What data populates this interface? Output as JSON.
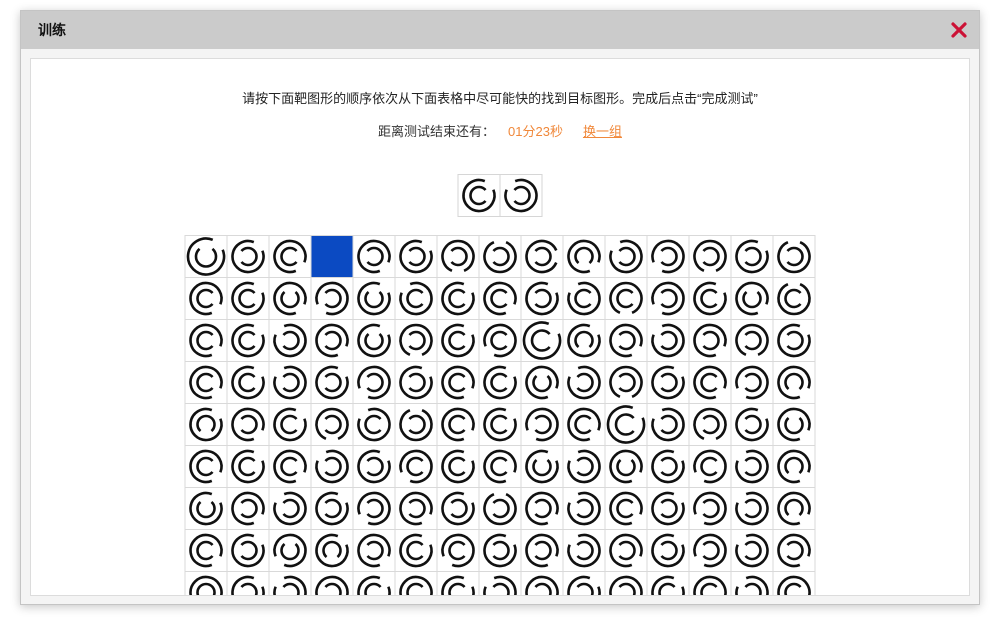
{
  "window": {
    "title": "训练"
  },
  "instructions": "请按下面靶图形的顺序依次从下面表格中尽可能快的找到目标图形。完成后点击“完成测试”",
  "timer": {
    "label": "距离测试结束还有：",
    "remaining": "01分23秒"
  },
  "reshuffle_link": "换一组",
  "targets": [
    "NE-E",
    "NW-W"
  ],
  "grid": {
    "rows": [
      [
        "NE-N-L",
        "NE-W",
        "SE-E",
        "selected",
        "SE-W",
        "NE-W",
        "S-W",
        "N-W",
        "E-W",
        "SE-S",
        "NW-W",
        "SW-W",
        "S-W",
        "NE-W",
        "N-W"
      ],
      [
        "SE-E",
        "NE-E",
        "SE-N",
        "SW-W",
        "NE-N",
        "NW-E",
        "NE-E",
        "SE-E",
        "NE-W",
        "NW-E",
        "S-E",
        "SW-W",
        "NE-E",
        "SE-N",
        "N-E"
      ],
      [
        "SE-E",
        "NE-E",
        "NW-W",
        "SE-W",
        "NE-N",
        "S-W",
        "NE-E",
        "SW-E",
        "NE-E-L",
        "NE-S",
        "SE-W",
        "NW-W",
        "SE-W",
        "S-W",
        "NE-W"
      ],
      [
        "SE-E",
        "NE-E",
        "NW-W",
        "NE-W",
        "SW-W",
        "NE-W",
        "SE-E",
        "NE-E",
        "SE-N",
        "NW-W",
        "S-W",
        "NE-W",
        "SE-E",
        "SW-W",
        "SE-S"
      ],
      [
        "NE-S",
        "SE-W",
        "NE-E",
        "S-W",
        "NW-E",
        "N-W",
        "SE-E",
        "NE-E",
        "SW-W",
        "SE-E",
        "NE-E-L",
        "NW-W",
        "S-W",
        "NE-W",
        "SE-N"
      ],
      [
        "SE-E",
        "NE-E",
        "SE-E",
        "NW-W",
        "NE-W",
        "SW-E",
        "NE-E",
        "SE-E",
        "NE-N",
        "NW-W",
        "SE-N",
        "NE-W",
        "SW-E",
        "NW-W",
        "SE-S"
      ],
      [
        "NE-N",
        "SE-W",
        "NW-W",
        "NE-W",
        "SW-W",
        "SE-W",
        "NE-W",
        "N-W",
        "SE-W",
        "NW-W",
        "SE-E",
        "NE-W",
        "SW-W",
        "NW-W",
        "SE-S"
      ],
      [
        "SE-E",
        "NE-W",
        "SW-N",
        "NE-S",
        "SE-W",
        "NE-E",
        "SW-E",
        "NE-W",
        "SE-W",
        "NW-W",
        "SE-W",
        "NE-W",
        "SW-W",
        "NW-W",
        "SE-W"
      ],
      [
        "SE-S",
        "NE-W",
        "NW-W",
        "SW-W",
        "NE-E",
        "SE-E",
        "NE-E",
        "NW-W",
        "SE-W",
        "NE-W",
        "SW-W",
        "NE-E",
        "SE-E",
        "NW-W",
        "SE-E"
      ]
    ]
  },
  "colors": {
    "title_bar": "#cbcbcb",
    "close": "#cc1236",
    "accent": "#f0883a",
    "selected_cell": "#0b4ac2",
    "grid_line": "#d9d9d9",
    "figure": "#111111"
  }
}
